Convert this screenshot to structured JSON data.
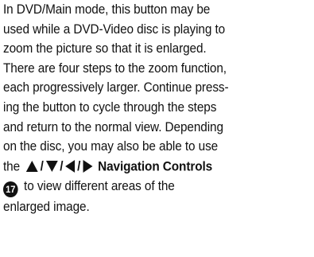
{
  "paragraph": {
    "line1": "In DVD/Main mode, this button may be",
    "line2": "used while a DVD-Video disc is playing to",
    "line3": "zoom the picture so that it is enlarged.",
    "line4": "There are four steps to the zoom function,",
    "line5": "each progressively larger. Continue press-",
    "line6": "ing the button to cycle through the steps",
    "line7": "and return to the normal view. Depending",
    "line8": "on the disc, you may also be able to use",
    "line9_prefix": "the",
    "nav_label": "Navigation Controls",
    "badge_number": "17",
    "line10_rest": "to view different areas of the",
    "line11": "enlarged image."
  }
}
